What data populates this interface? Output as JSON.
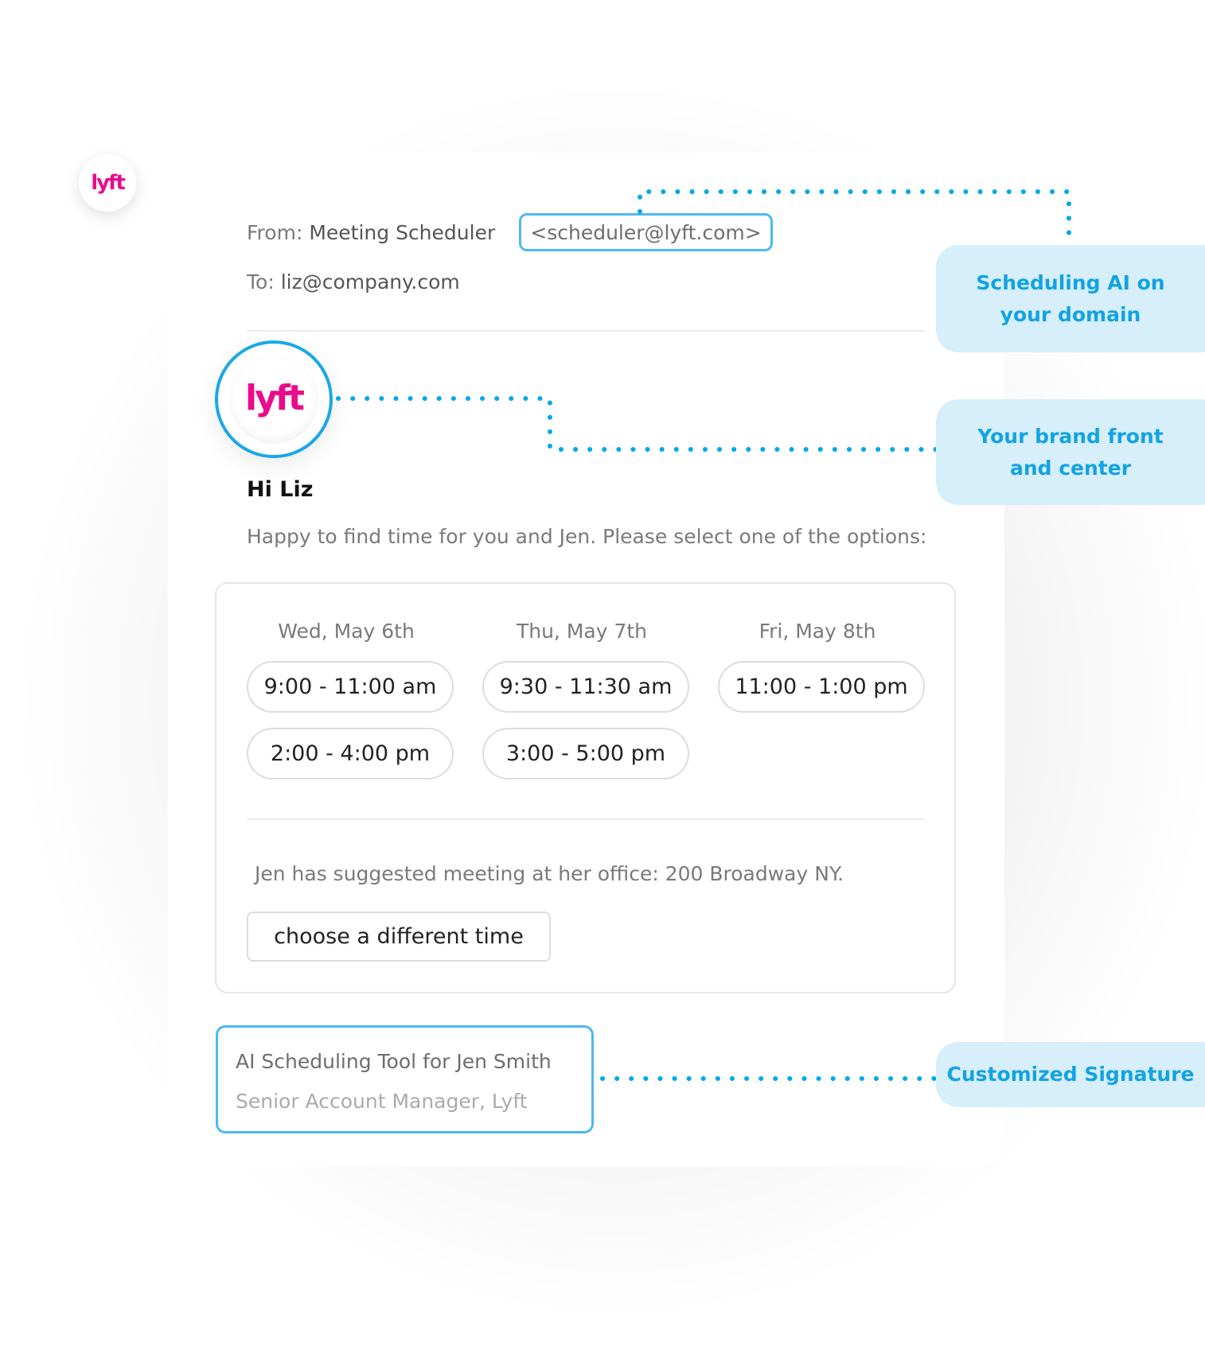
{
  "brand": {
    "name": "lyft",
    "logo_icon": "lyft-logo-icon",
    "color": "#EA0B8C",
    "accent": "#12A3E3",
    "callout_bg": "#D7EEFB"
  },
  "email": {
    "from_label": "From:",
    "from_name": "Meeting Scheduler",
    "from_address": "<scheduler@lyft.com>",
    "to_label": "To:",
    "to_address": "liz@company.com",
    "greeting": "Hi Liz",
    "intro": "Happy to find time for you and Jen. Please select one of the options:"
  },
  "options": {
    "days": [
      {
        "label": "Wed, May 6th",
        "slots": [
          "9:00 - 11:00 am",
          "2:00 - 4:00 pm"
        ]
      },
      {
        "label": "Thu, May 7th",
        "slots": [
          "9:30 - 11:30 am",
          "3:00 - 5:00 pm"
        ]
      },
      {
        "label": "Fri, May 8th",
        "slots": [
          "11:00 - 1:00 pm"
        ]
      }
    ],
    "location_note": "Jen has suggested meeting at her office: 200 Broadway NY.",
    "choose_different_label": "choose a different time"
  },
  "signature": {
    "name": "AI Scheduling Tool for Jen Smith",
    "title": "Senior Account Manager, Lyft"
  },
  "callouts": [
    {
      "line1": "Scheduling AI on",
      "line2": "your domain"
    },
    {
      "line1": "Your brand front",
      "line2": "and center"
    },
    {
      "line1": "Customized Signature"
    }
  ]
}
